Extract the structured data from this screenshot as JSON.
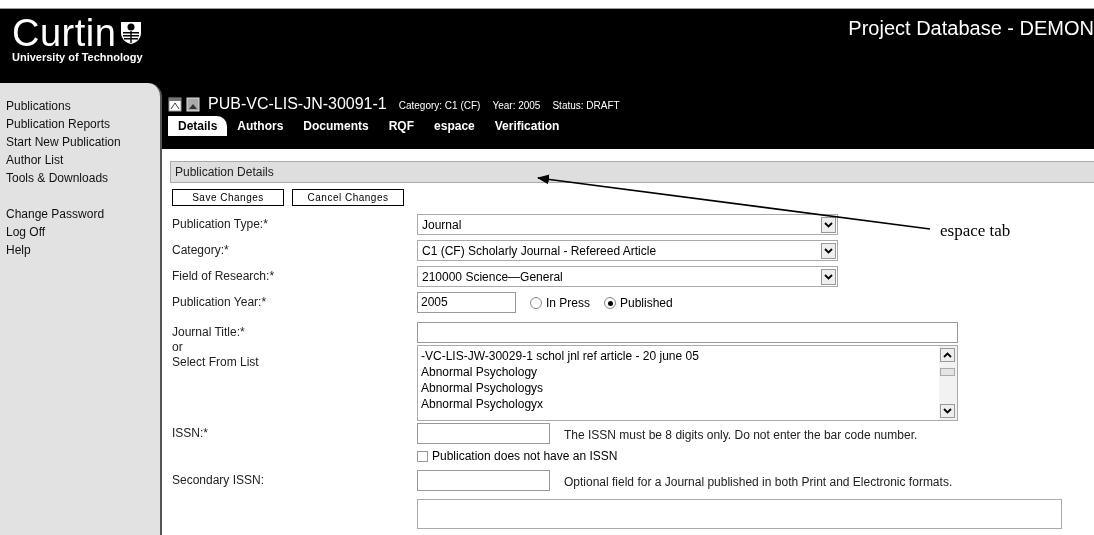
{
  "header": {
    "logo_name": "Curtin",
    "logo_subtitle": "University of Technology",
    "title": "Project Database - DEMON"
  },
  "sidebar": {
    "groups": [
      [
        "Publications",
        "Publication Reports",
        "Start New Publication",
        "Author List",
        "Tools & Downloads"
      ],
      [
        "Change Password",
        "Log Off",
        "Help"
      ]
    ]
  },
  "record": {
    "id": "PUB-VC-LIS-JN-30091-1",
    "meta": [
      "Category: C1 (CF)",
      "Year: 2005",
      "Status: DRAFT"
    ]
  },
  "tabs": [
    {
      "label": "Details",
      "selected": true
    },
    {
      "label": "Authors",
      "selected": false
    },
    {
      "label": "Documents",
      "selected": false
    },
    {
      "label": "RQF",
      "selected": false
    },
    {
      "label": "espace",
      "selected": false
    },
    {
      "label": "Verification",
      "selected": false
    }
  ],
  "section": {
    "title": "Publication Details"
  },
  "buttons": [
    "Save Changes",
    "Cancel Changes"
  ],
  "fields": [
    {
      "kind": "select",
      "label": "Publication Type:*",
      "value": "Journal"
    },
    {
      "kind": "select",
      "label": "Category:*",
      "value": "C1 (CF) Scholarly Journal - Refereed Article"
    },
    {
      "kind": "select",
      "label": "Field of Research:*",
      "value": "210000 Science—General"
    },
    {
      "kind": "year",
      "label": "Publication Year:*",
      "value": "2005",
      "options": [
        {
          "label": "In Press",
          "selected": false
        },
        {
          "label": "Published",
          "selected": true
        }
      ]
    },
    {
      "kind": "journal",
      "label": "Journal Title:*",
      "or": "or",
      "list_label": "Select From List",
      "list": [
        "-VC-LIS-JW-30029-1 schol jnl ref article - 20 june 05",
        "Abnormal Psychology",
        "Abnormal Psychologys",
        "Abnormal Psychologyx"
      ]
    },
    {
      "kind": "issn",
      "label": "ISSN:*",
      "hint": "The ISSN must be 8 digits only. Do not enter the bar code number.",
      "checkbox": {
        "label": "Publication does not have an ISSN",
        "checked": false
      }
    },
    {
      "kind": "issn",
      "label": "Secondary ISSN:",
      "hint": "Optional field for a Journal published in both Print and Electronic formats."
    },
    {
      "kind": "partial"
    }
  ],
  "callout": {
    "label": "espace tab"
  }
}
